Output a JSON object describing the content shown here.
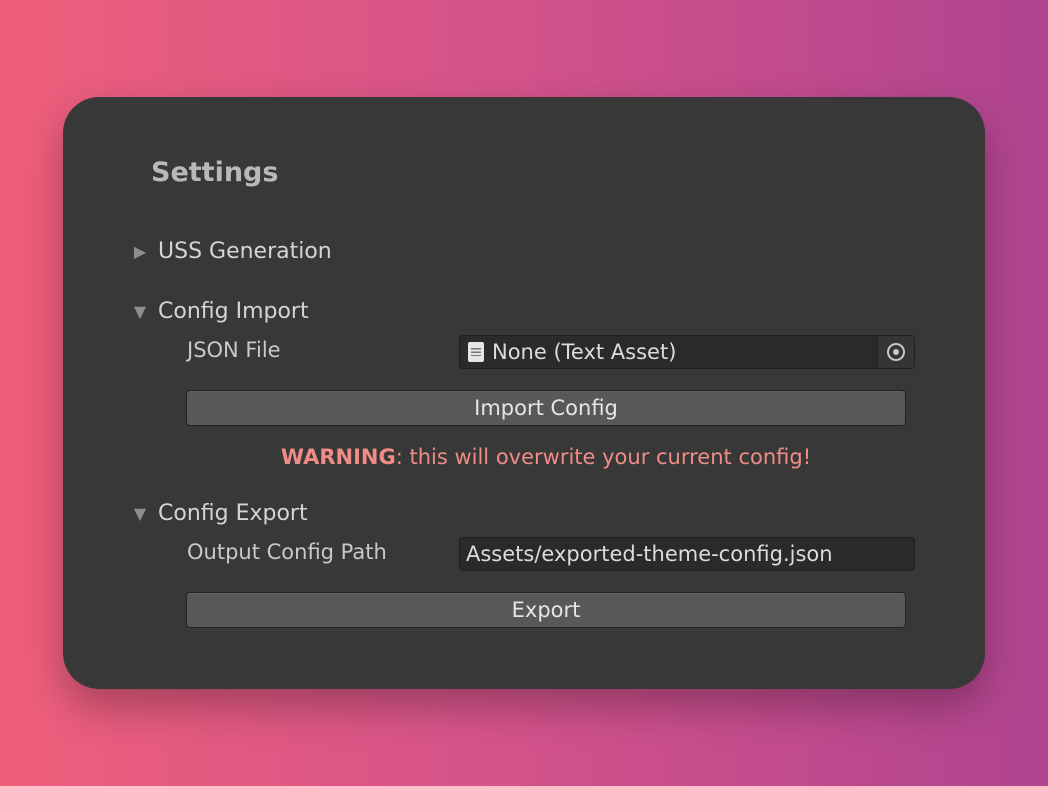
{
  "panel": {
    "title": "Settings"
  },
  "sections": {
    "uss_generation": {
      "label": "USS Generation",
      "expanded": false
    },
    "config_import": {
      "label": "Config Import",
      "expanded": true,
      "json_file_label": "JSON  File",
      "json_file_value": "None (Text Asset)",
      "import_button_label": "Import Config",
      "warning_prefix": "WARNING",
      "warning_text": ": this will overwrite your current config!"
    },
    "config_export": {
      "label": "Config Export",
      "expanded": true,
      "output_path_label": "Output Config Path",
      "output_path_value": "Assets/exported-theme-config.json",
      "export_button_label": "Export"
    }
  },
  "icons": {
    "collapsed": "triangle-right-icon",
    "expanded": "triangle-down-icon",
    "text_asset": "document-icon",
    "object_picker": "target-icon"
  },
  "colors": {
    "panel_bg": "#383838",
    "warning": "#f08c85",
    "button_bg": "#585858",
    "field_bg": "#2a2a2a"
  }
}
